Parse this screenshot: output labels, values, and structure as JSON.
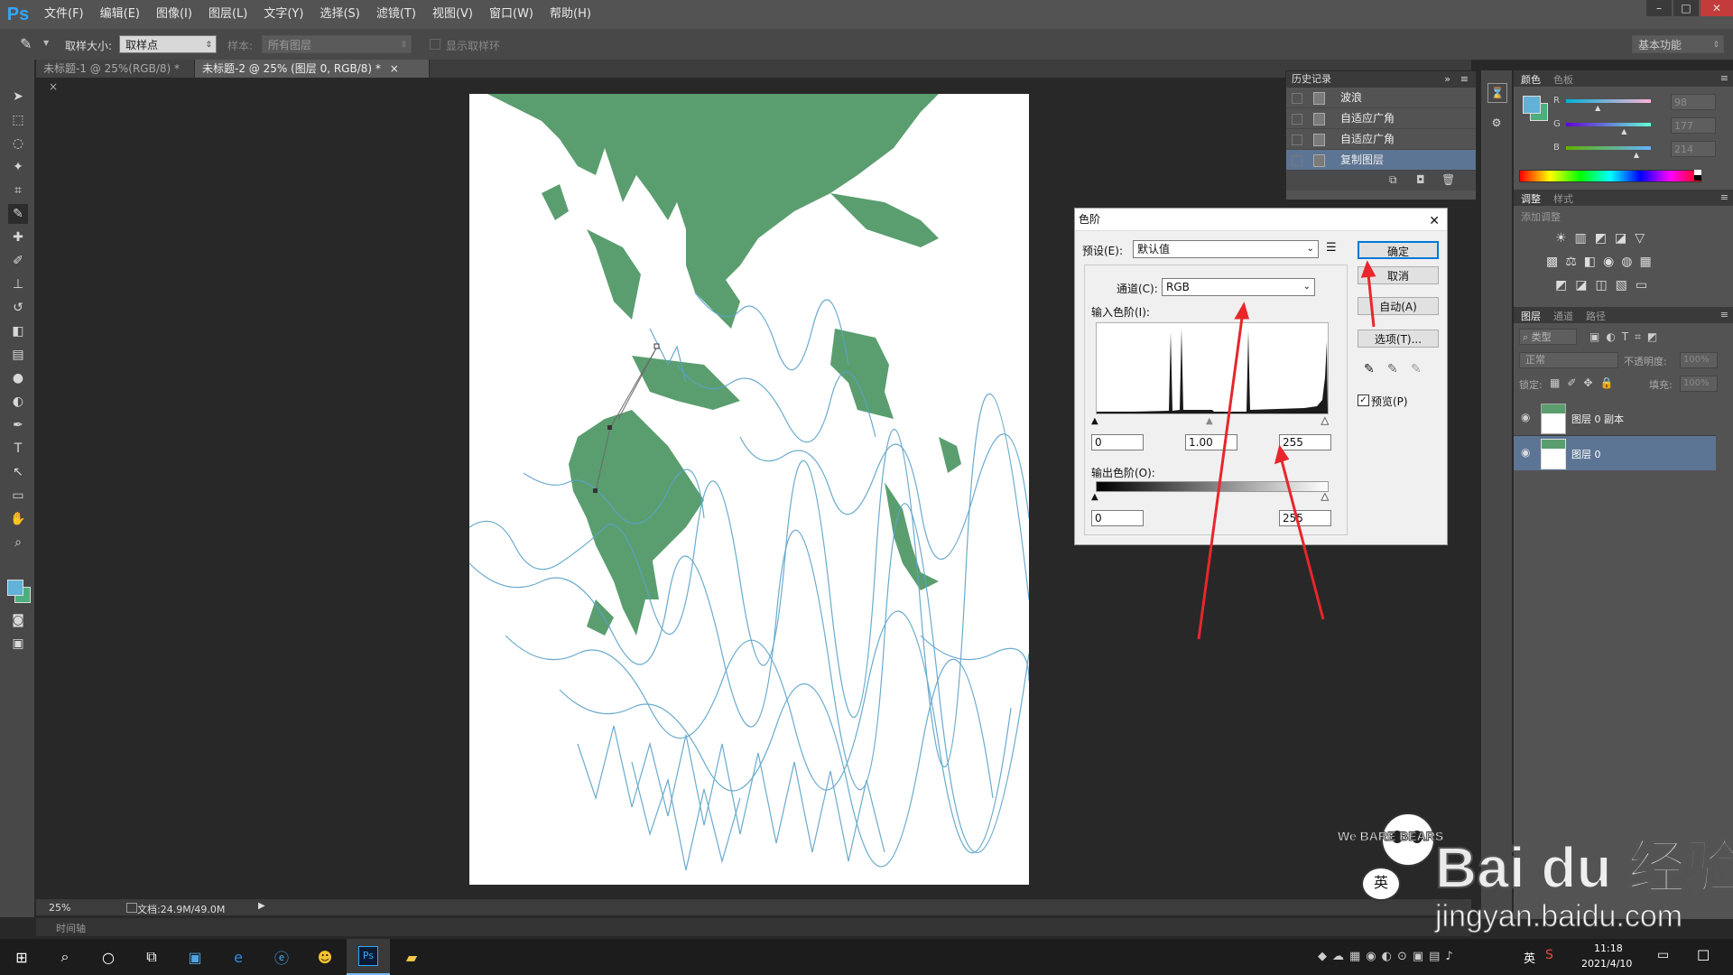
{
  "app": {
    "logo": "Ps",
    "menus": [
      "文件(F)",
      "编辑(E)",
      "图像(I)",
      "图层(L)",
      "文字(Y)",
      "选择(S)",
      "滤镜(T)",
      "视图(V)",
      "窗口(W)",
      "帮助(H)"
    ],
    "window_controls": [
      "–",
      "□",
      "✕"
    ]
  },
  "options": {
    "sample_size_label": "取样大小:",
    "sample_size_value": "取样点",
    "sample_label": "样本:",
    "sample_value": "所有图层",
    "show_ring_label": "显示取样环",
    "workspace": "基本功能"
  },
  "tabs": [
    {
      "label": "未标题-1 @ 25%(RGB/8) *",
      "close": "×"
    },
    {
      "label": "未标题-2 @ 25% (图层 0, RGB/8) *",
      "close": "×"
    }
  ],
  "status": {
    "zoom": "25%",
    "doc": "文档:24.9M/49.0M",
    "timeline": "时间轴"
  },
  "history": {
    "title": "历史记录",
    "items": [
      "波浪",
      "自适应广角",
      "自适应广角",
      "复制图层"
    ],
    "selected_index": 3
  },
  "color_panel": {
    "tabs": [
      "颜色",
      "色板"
    ],
    "channels": [
      {
        "label": "R",
        "value": "98",
        "fraction": 0.384
      },
      {
        "label": "G",
        "value": "177",
        "fraction": 0.694
      },
      {
        "label": "B",
        "value": "214",
        "fraction": 0.839
      }
    ],
    "foreground": "#62b1d6",
    "background": "#4caf7d"
  },
  "adjust_panel": {
    "tabs": [
      "调整",
      "样式"
    ],
    "add_label": "添加调整"
  },
  "layers_panel": {
    "tabs": [
      "图层",
      "通道",
      "路径"
    ],
    "filter_label": "类型",
    "blend_mode": "正常",
    "opacity_label": "不透明度:",
    "opacity_value": "100%",
    "lock_label": "锁定:",
    "fill_label": "填充:",
    "fill_value": "100%",
    "layers": [
      {
        "name": "图层 0 副本",
        "selected": false
      },
      {
        "name": "图层 0",
        "selected": true
      }
    ]
  },
  "levels_dialog": {
    "title": "色阶",
    "close": "✕",
    "preset_label": "预设(E):",
    "preset_value": "默认值",
    "channel_label": "通道(C):",
    "channel_value": "RGB",
    "input_label": "输入色阶(I):",
    "input_black": "0",
    "input_gamma": "1.00",
    "input_white": "255",
    "output_label": "输出色阶(O):",
    "output_black": "0",
    "output_white": "255",
    "buttons": {
      "ok": "确定",
      "cancel": "取消",
      "auto": "自动(A)",
      "options": "选项(T)..."
    },
    "preview_label": "预览(P)",
    "preview_checked": true,
    "histogram_note": "tall spikes near 33%, 51%, 100% of range"
  },
  "watermark": {
    "brand": "Bai du 经验",
    "url": "jingyan.baidu.com",
    "badge": "We BARE BEARS",
    "badge_char": "英"
  },
  "taskbar": {
    "time": "11:18",
    "date": "2021/4/10",
    "ime": "英"
  },
  "colors": {
    "ps_blue": "#31a8ff",
    "green_shape": "#5a9e6f",
    "blue_lines": "#5aa2c8",
    "annotation_red": "#e8262b",
    "selection_blue": "#5d7594"
  }
}
